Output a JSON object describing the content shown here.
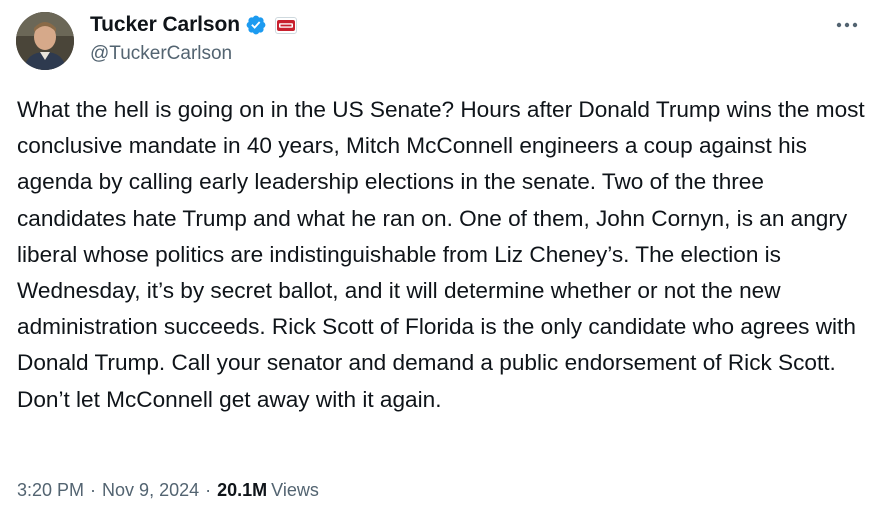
{
  "author": {
    "display_name": "Tucker Carlson",
    "handle": "@TuckerCarlson",
    "verified": true,
    "verified_color": "#1d9bf0",
    "affiliate_badge_icon": "tcn-logo-icon",
    "avatar_icon": "profile-photo"
  },
  "tweet": {
    "text": "What the hell is going on in the US Senate? Hours after Donald Trump wins the most conclusive mandate in 40 years, Mitch McConnell engineers a coup against his agenda by calling early leadership elections in the senate. Two of the three candidates hate Trump and what he ran on. One of them, John Cornyn, is an angry liberal whose politics are indistinguishable from Liz Cheney’s. The election is Wednesday, it’s by secret ballot, and it will determine whether or not the new administration succeeds. Rick Scott of Florida is the only candidate who agrees with Donald Trump. Call your senator and demand a public endorsement of Rick Scott. Don’t let McConnell get away with it again."
  },
  "meta": {
    "time": "3:20 PM",
    "separator": "·",
    "date": "Nov 9, 2024",
    "views_count": "20.1M",
    "views_label": "Views"
  },
  "colors": {
    "text_primary": "#0f1419",
    "text_secondary": "#536471",
    "background": "#ffffff"
  }
}
